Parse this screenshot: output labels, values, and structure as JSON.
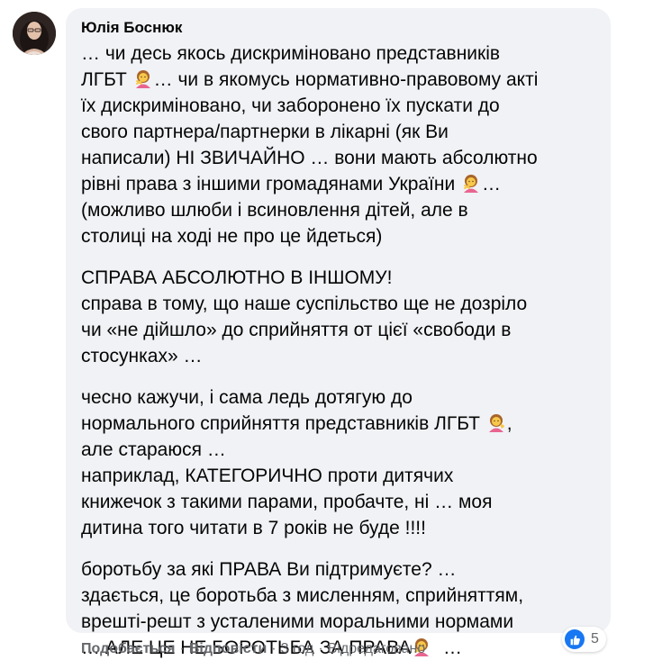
{
  "comment": {
    "author": "Юлія Боснюк",
    "paragraphs": [
      [
        "… чи десь якось дискриміновано представників",
        [
          "ЛГБТ ",
          "woman-gesturing-no",
          "… чи в якомусь нормативно-правовому акті"
        ],
        "їх дискриміновано, чи заборонено їх пускати до",
        "свого партнера/партнерки в лікарні (як Ви",
        "написали) НІ ЗВИЧАЙНО … вони мають абсолютно",
        [
          "рівні права з іншими громадянами України ",
          "woman-gesturing-no",
          "…"
        ],
        "(можливо шлюби і всиновлення дітей, але в",
        "столиці на ході не про це йдеться)"
      ],
      [
        "СПРАВА АБСОЛЮТНО В ІНШОМУ!",
        "справа в тому, що наше суспільство ще не дозріло",
        "чи «не дійшло» до сприйняття от цієї «свободи в",
        "стосунках» …"
      ],
      [
        "чесно кажучи, і сама ледь дотягую до",
        [
          "нормального сприйняття представників ЛГБТ ",
          "woman-tipping-hand",
          ","
        ],
        "але стараюся …",
        "наприклад, КАТЕГОРИЧНО проти дитячих",
        "книжечок з такими парами, пробачте, ні … моя",
        "дитина того читати в 7 років не буде !!!!"
      ],
      [
        "боротьбу за які ПРАВА Ви підтримуєте? …",
        "здається, це боротьба з мисленням, сприйняттям,",
        "врешті-решт з усталеними моральними нормами",
        [
          "… АЛЕ ЦЕ НЕ БОРОТЬБА ЗА ПРАВА",
          "woman-gesturing-no",
          "  …"
        ]
      ]
    ]
  },
  "actions": {
    "like": "Подобається",
    "reply": "Відповісти",
    "time": "3 год",
    "edited": "Відредаговано",
    "separator": "·"
  },
  "reactions": {
    "icon": "like-icon",
    "count": "5",
    "color": "#1877f2"
  },
  "colors": {
    "bubble": "#f0f2f5",
    "text": "#050505",
    "secondary": "#65676b"
  }
}
